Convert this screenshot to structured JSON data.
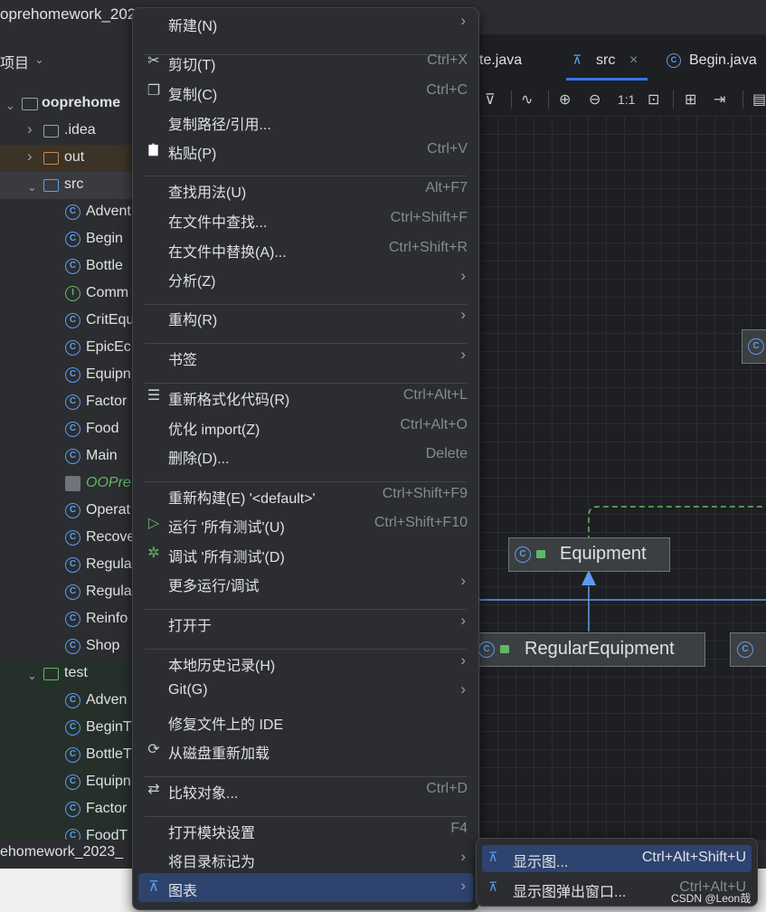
{
  "window": {
    "project_title": "oprehomework_2023"
  },
  "project_panel": {
    "header": "项目",
    "root": "ooprehome",
    "items": [
      {
        "label": ".idea"
      },
      {
        "label": "out"
      },
      {
        "label": "src"
      },
      {
        "label": "Advent"
      },
      {
        "label": "Begin"
      },
      {
        "label": "Bottle"
      },
      {
        "label": "Comm"
      },
      {
        "label": "CritEqu"
      },
      {
        "label": "EpicEc"
      },
      {
        "label": "Equipn"
      },
      {
        "label": "Factor"
      },
      {
        "label": "Food"
      },
      {
        "label": "Main"
      },
      {
        "label": "OOPre"
      },
      {
        "label": "Operat"
      },
      {
        "label": "Recove"
      },
      {
        "label": "Regula"
      },
      {
        "label": "Regula"
      },
      {
        "label": "Reinfo"
      },
      {
        "label": "Shop"
      },
      {
        "label": "test"
      },
      {
        "label": "Adven"
      },
      {
        "label": "BeginT"
      },
      {
        "label": "BottleT"
      },
      {
        "label": "Equipn"
      },
      {
        "label": "Factor"
      },
      {
        "label": "FoodT"
      }
    ],
    "bottom_title": "ehomework_2023_"
  },
  "editor": {
    "tabs": [
      {
        "label": "te.java"
      },
      {
        "label": "src"
      },
      {
        "label": "Begin.java"
      }
    ],
    "toolbar_zoom": "1:1",
    "nodes": {
      "equipment": "Equipment",
      "regular_equipment": "RegularEquipment"
    }
  },
  "context_menu": {
    "items": [
      {
        "label": "新建(N)",
        "shortcut": ""
      },
      {
        "label": "剪切(T)",
        "shortcut": "Ctrl+X"
      },
      {
        "label": "复制(C)",
        "shortcut": "Ctrl+C"
      },
      {
        "label": "复制路径/引用...",
        "shortcut": ""
      },
      {
        "label": "粘贴(P)",
        "shortcut": "Ctrl+V"
      },
      {
        "label": "查找用法(U)",
        "shortcut": "Alt+F7"
      },
      {
        "label": "在文件中查找...",
        "shortcut": "Ctrl+Shift+F"
      },
      {
        "label": "在文件中替换(A)...",
        "shortcut": "Ctrl+Shift+R"
      },
      {
        "label": "分析(Z)",
        "shortcut": ""
      },
      {
        "label": "重构(R)",
        "shortcut": ""
      },
      {
        "label": "书签",
        "shortcut": ""
      },
      {
        "label": "重新格式化代码(R)",
        "shortcut": "Ctrl+Alt+L"
      },
      {
        "label": "优化 import(Z)",
        "shortcut": "Ctrl+Alt+O"
      },
      {
        "label": "删除(D)...",
        "shortcut": "Delete"
      },
      {
        "label": "重新构建(E) '<default>'",
        "shortcut": "Ctrl+Shift+F9"
      },
      {
        "label": "运行 '所有测试'(U)",
        "shortcut": "Ctrl+Shift+F10"
      },
      {
        "label": "调试 '所有测试'(D)",
        "shortcut": ""
      },
      {
        "label": "更多运行/调试",
        "shortcut": ""
      },
      {
        "label": "打开于",
        "shortcut": ""
      },
      {
        "label": "本地历史记录(H)",
        "shortcut": ""
      },
      {
        "label": "Git(G)",
        "shortcut": ""
      },
      {
        "label": "修复文件上的 IDE",
        "shortcut": ""
      },
      {
        "label": "从磁盘重新加载",
        "shortcut": ""
      },
      {
        "label": "比较对象...",
        "shortcut": "Ctrl+D"
      },
      {
        "label": "打开模块设置",
        "shortcut": "F4"
      },
      {
        "label": "将目录标记为",
        "shortcut": ""
      },
      {
        "label": "图表",
        "shortcut": ""
      }
    ]
  },
  "submenu": {
    "items": [
      {
        "label": "显示图...",
        "shortcut": "Ctrl+Alt+Shift+U"
      },
      {
        "label": "显示图弹出窗口...",
        "shortcut": "Ctrl+Alt+U"
      }
    ]
  },
  "watermark": "CSDN @Leon哉",
  "colors": {
    "accent": "#3574f0",
    "selection": "#2e436e",
    "class_icon": "#5c9ded",
    "interface_icon": "#5fb865",
    "out_folder": "#c98b53"
  }
}
